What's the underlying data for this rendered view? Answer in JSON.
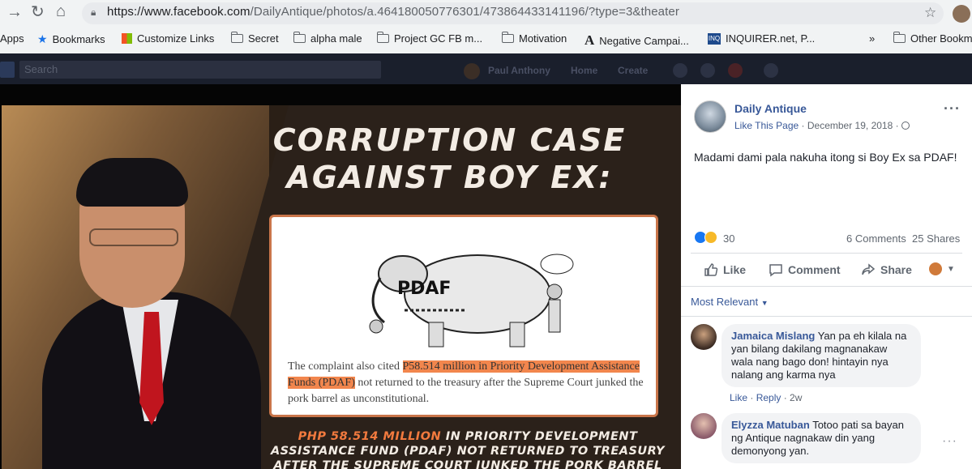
{
  "browser": {
    "url_host": "https://www.facebook.com",
    "url_path": "/DailyAntique/photos/a.464180050776301/473864433141196/?type=3&theater",
    "bookmarks": [
      {
        "label": "Apps"
      },
      {
        "label": "Bookmarks"
      },
      {
        "label": "Customize Links"
      },
      {
        "label": "Secret"
      },
      {
        "label": "alpha male"
      },
      {
        "label": "Project GC FB m..."
      },
      {
        "label": "Motivation"
      },
      {
        "label": "Negative Campai..."
      },
      {
        "label": "INQUIRER.net, P..."
      },
      {
        "label": "»"
      },
      {
        "label": "Other Bookm"
      }
    ]
  },
  "fb_bar": {
    "search_placeholder": "Search",
    "user": "Paul Anthony",
    "home": "Home",
    "create": "Create"
  },
  "poster": {
    "headline_line1": "CORRUPTION CASE",
    "headline_line2": "AGAINST BOY EX:",
    "cartoon_label": "PDAF",
    "quote_pre": "The complaint also cited ",
    "quote_hl1": "P58.514 million in Priority Development Assistance",
    "quote_hl2": "Funds (PDAF)",
    "quote_post": " not returned to the treasury after the Supreme Court junked the pork barrel as unconstitutional.",
    "bottom_orange": "PHP 58.514 MILLION",
    "bottom_rest": " IN PRIORITY DEVELOPMENT ASSISTANCE FUND (PDAF) NOT RETURNED TO TREASURY AFTER THE SUPREME COURT JUNKED THE PORK BARREL AS UNCONSTITUTIONAL"
  },
  "post": {
    "page_name": "Daily Antique",
    "like_page": "Like This Page",
    "date": "December 19, 2018",
    "separator": "·",
    "text": "Madami dami pala nakuha itong si Boy Ex sa PDAF!",
    "reaction_count": "30",
    "comments": "6 Comments",
    "shares": "25 Shares",
    "actions": {
      "like": "Like",
      "comment": "Comment",
      "share": "Share"
    },
    "sort": "Most Relevant",
    "colors": {
      "link": "#385898",
      "like_blue": "#1877f2",
      "wow_yellow": "#f7b928"
    }
  },
  "comments": [
    {
      "name": "Jamaica Mislang",
      "text": "Yan pa eh kilala na yan bilang dakilang magnanakaw wala nang bago don! hintayin nya nalang ang karma nya",
      "like": "Like",
      "reply": "Reply",
      "age": "2w"
    },
    {
      "name": "Elyzza Matuban",
      "text": "Totoo pati sa bayan ng Antique nagnakaw din yang demonyong yan."
    }
  ]
}
